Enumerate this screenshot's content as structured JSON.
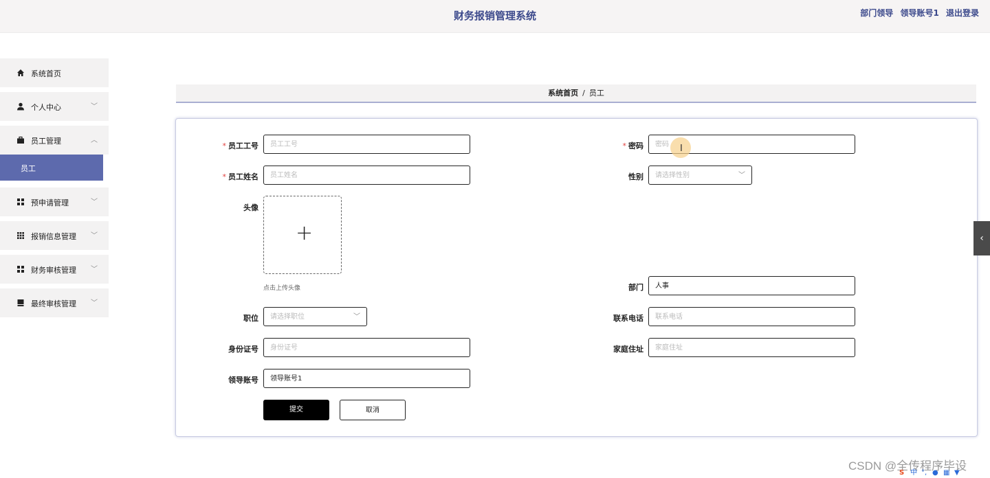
{
  "header": {
    "title": "财务报销管理系统",
    "role": "部门领导",
    "account": "领导账号1",
    "logout": "退出登录"
  },
  "sidebar": {
    "items": [
      {
        "label": "系统首页",
        "icon": "home-icon"
      },
      {
        "label": "个人中心",
        "icon": "person-icon"
      },
      {
        "label": "员工管理",
        "icon": "briefcase-icon",
        "expanded": true
      },
      {
        "label": "预申请管理",
        "icon": "grid-icon"
      },
      {
        "label": "报销信息管理",
        "icon": "grid9-icon"
      },
      {
        "label": "财务审核管理",
        "icon": "grid-icon"
      },
      {
        "label": "最终审核管理",
        "icon": "card-icon"
      }
    ],
    "subitem": "员工"
  },
  "breadcrumb": {
    "home": "系统首页",
    "sep": "/",
    "current": "员工"
  },
  "form": {
    "employee_id": {
      "label": "员工工号",
      "placeholder": "员工工号"
    },
    "password": {
      "label": "密码",
      "placeholder": "密码"
    },
    "employee_name": {
      "label": "员工姓名",
      "placeholder": "员工姓名"
    },
    "gender": {
      "label": "性别",
      "placeholder": "请选择性别"
    },
    "avatar": {
      "label": "头像",
      "hint": "点击上传头像"
    },
    "department": {
      "label": "部门",
      "value": "人事"
    },
    "position": {
      "label": "职位",
      "placeholder": "请选择职位"
    },
    "phone": {
      "label": "联系电话",
      "placeholder": "联系电话"
    },
    "id_number": {
      "label": "身份证号",
      "placeholder": "身份证号"
    },
    "address": {
      "label": "家庭住址",
      "placeholder": "家庭住址"
    },
    "leader_account": {
      "label": "领导账号",
      "value": "领导账号1"
    },
    "submit": "提交",
    "cancel": "取消"
  },
  "watermark": "CSDN @全传程序毕设",
  "colors": {
    "accent": "#5d6aad",
    "title": "#3d4a8c",
    "required": "#e0403e"
  }
}
